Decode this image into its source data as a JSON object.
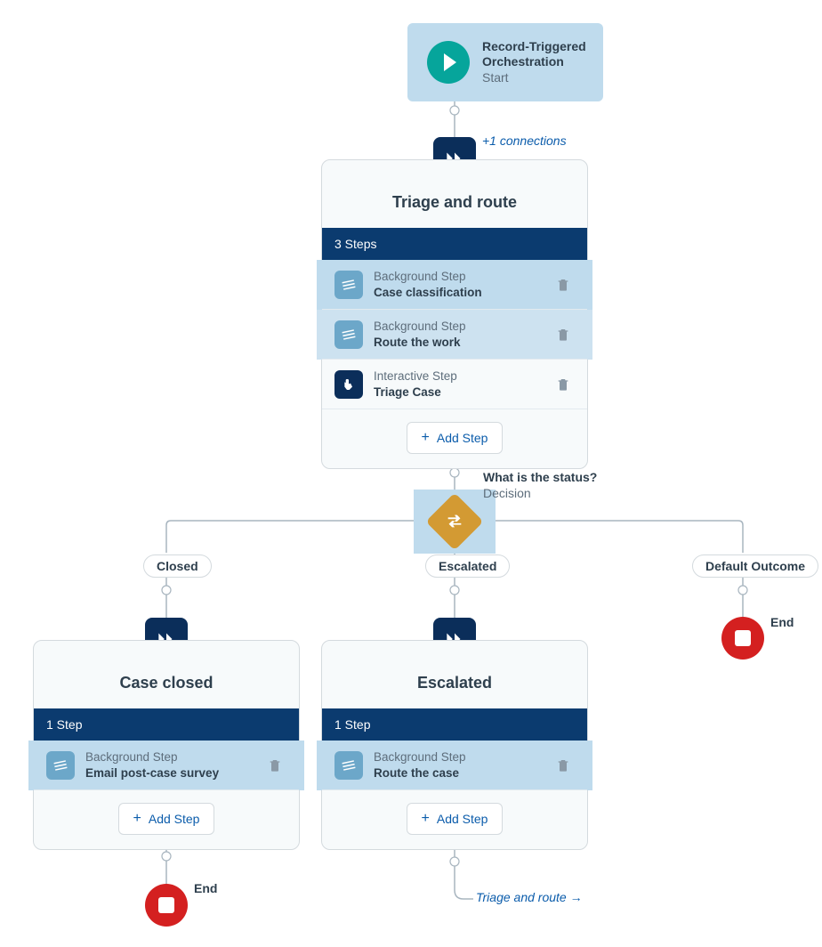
{
  "start": {
    "title_line1": "Record-Triggered",
    "title_line2": "Orchestration",
    "subtitle": "Start"
  },
  "extra_connections_label": "+1 connections",
  "stages": {
    "triage": {
      "title": "Triage and route",
      "steps_header": "3 Steps",
      "steps": [
        {
          "type": "Background Step",
          "name": "Case classification"
        },
        {
          "type": "Background Step",
          "name": "Route the work"
        },
        {
          "type": "Interactive Step",
          "name": "Triage Case"
        }
      ],
      "add_label": "Add Step"
    },
    "closed_stage": {
      "title": "Case closed",
      "steps_header": "1 Step",
      "steps": [
        {
          "type": "Background Step",
          "name": "Email post-case survey"
        }
      ],
      "add_label": "Add Step"
    },
    "escalated_stage": {
      "title": "Escalated",
      "steps_header": "1 Step",
      "steps": [
        {
          "type": "Background Step",
          "name": "Route the case"
        }
      ],
      "add_label": "Add Step"
    }
  },
  "decision": {
    "question": "What is the status?",
    "type": "Decision"
  },
  "outcomes": {
    "closed": "Closed",
    "escalated": "Escalated",
    "default": "Default Outcome"
  },
  "end_label": "End",
  "goto": {
    "target": "Triage and route",
    "arrow": "→"
  }
}
